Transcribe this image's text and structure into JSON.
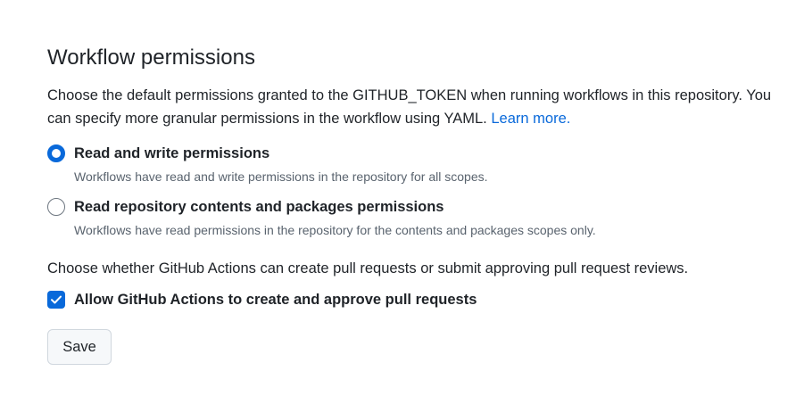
{
  "section": {
    "title": "Workflow permissions",
    "description": "Choose the default permissions granted to the GITHUB_TOKEN when running workflows in this repository. You can specify more granular permissions in the workflow using YAML.",
    "learn_more": "Learn more."
  },
  "permissions": {
    "selected": "read-write",
    "options": [
      {
        "id": "read-write",
        "label": "Read and write permissions",
        "note": "Workflows have read and write permissions in the repository for all scopes."
      },
      {
        "id": "read-only",
        "label": "Read repository contents and packages permissions",
        "note": "Workflows have read permissions in the repository for the contents and packages scopes only."
      }
    ]
  },
  "pull_requests": {
    "description": "Choose whether GitHub Actions can create pull requests or submit approving pull request reviews.",
    "checkbox_label": "Allow GitHub Actions to create and approve pull requests",
    "checked": true
  },
  "actions": {
    "save_label": "Save"
  },
  "colors": {
    "accent": "#0969da",
    "text": "#1f2328",
    "muted": "#59636e",
    "button_bg": "#f6f8fa",
    "border": "#d0d7de"
  }
}
